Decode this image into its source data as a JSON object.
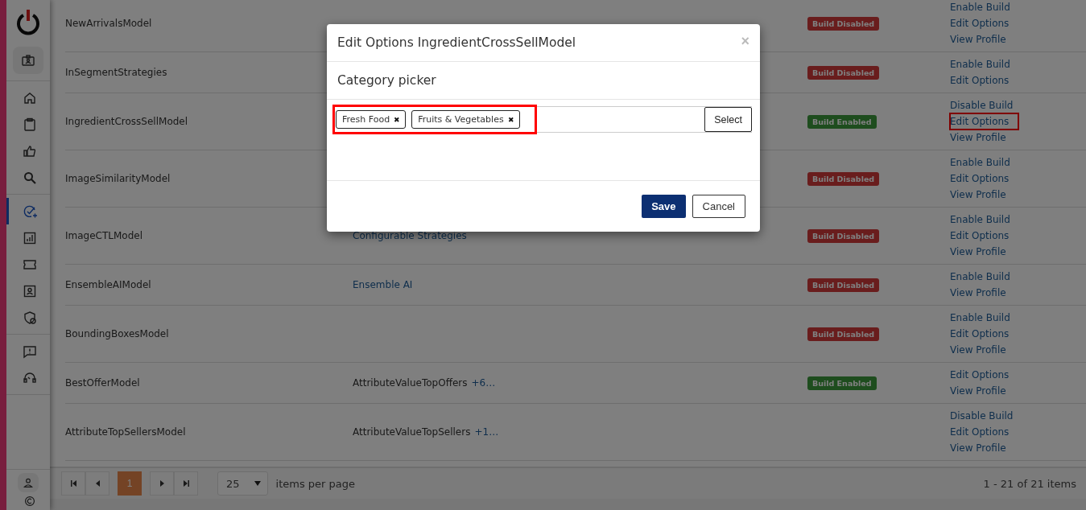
{
  "sidebar": {
    "groups": [
      {
        "items": [
          {
            "selected": false
          }
        ]
      },
      {
        "items": [
          {
            "selected": false
          },
          {
            "selected": false
          },
          {
            "selected": false
          },
          {
            "selected": false
          }
        ]
      },
      {
        "items": [
          {
            "selected": true
          },
          {
            "selected": false
          },
          {
            "selected": false
          },
          {
            "selected": false
          },
          {
            "selected": false
          }
        ]
      },
      {
        "items": [
          {
            "selected": false
          },
          {
            "selected": false
          }
        ]
      }
    ],
    "footer": [
      {
        "selected": false
      },
      {
        "selected": false
      }
    ]
  },
  "table": {
    "rows": [
      {
        "name": "NewArrivalsModel",
        "status": {
          "label": "Build Disabled",
          "kind": "disabled"
        },
        "actions": [
          {
            "label": "Enable Build",
            "highlighted": false
          },
          {
            "label": "Edit Options",
            "highlighted": false
          },
          {
            "label": "View Profile",
            "highlighted": false
          }
        ]
      },
      {
        "name": "InSegmentStrategies",
        "status": {
          "label": "Build Disabled",
          "kind": "disabled"
        },
        "actions": [
          {
            "label": "Enable Build",
            "highlighted": false
          },
          {
            "label": "Edit Options",
            "highlighted": false
          }
        ]
      },
      {
        "name": "IngredientCrossSellModel",
        "status": {
          "label": "Build Enabled",
          "kind": "enabled"
        },
        "actions": [
          {
            "label": "Disable Build",
            "highlighted": false
          },
          {
            "label": "Edit Options",
            "highlighted": true
          },
          {
            "label": "View Profile",
            "highlighted": false
          }
        ]
      },
      {
        "name": "ImageSimilarityModel",
        "status": {
          "label": "Build Disabled",
          "kind": "disabled"
        },
        "actions": [
          {
            "label": "Enable Build",
            "highlighted": false
          },
          {
            "label": "Edit Options",
            "highlighted": false
          },
          {
            "label": "View Profile",
            "highlighted": false
          }
        ]
      },
      {
        "name": "ImageCTLModel",
        "strategy": {
          "label": "Configurable Strategies",
          "kind": "link"
        },
        "status": {
          "label": "Build Disabled",
          "kind": "disabled"
        },
        "actions": [
          {
            "label": "Enable Build",
            "highlighted": false
          },
          {
            "label": "Edit Options",
            "highlighted": false
          },
          {
            "label": "View Profile",
            "highlighted": false
          }
        ]
      },
      {
        "name": "EnsembleAIModel",
        "strategy": {
          "label": "Ensemble AI",
          "kind": "link"
        },
        "status": {
          "label": "Build Disabled",
          "kind": "disabled"
        },
        "actions": [
          {
            "label": "Enable Build",
            "highlighted": false
          },
          {
            "label": "View Profile",
            "highlighted": false
          }
        ]
      },
      {
        "name": "BoundingBoxesModel",
        "status": {
          "label": "Build Disabled",
          "kind": "disabled"
        },
        "actions": [
          {
            "label": "Enable Build",
            "highlighted": false
          },
          {
            "label": "Edit Options",
            "highlighted": false
          },
          {
            "label": "View Profile",
            "highlighted": false
          }
        ]
      },
      {
        "name": "BestOfferModel",
        "strategy": {
          "label": "AttributeValueTopOffers",
          "kind": "text",
          "more": "+6…"
        },
        "status": {
          "label": "Build Enabled",
          "kind": "enabled"
        },
        "actions": [
          {
            "label": "Edit Options",
            "highlighted": false
          },
          {
            "label": "View Profile",
            "highlighted": false
          }
        ]
      },
      {
        "name": "AttributeTopSellersModel",
        "strategy": {
          "label": "AttributeValueTopSellers",
          "kind": "text",
          "more": "+1…"
        },
        "actions": [
          {
            "label": "Disable Build",
            "highlighted": false
          },
          {
            "label": "Edit Options",
            "highlighted": false
          },
          {
            "label": "View Profile",
            "highlighted": false
          }
        ]
      }
    ]
  },
  "pager": {
    "buttons": [
      {
        "kind": "first"
      },
      {
        "kind": "prev"
      }
    ],
    "pages": [
      {
        "label": "1",
        "selected": true
      }
    ],
    "buttons_after": [
      {
        "kind": "next"
      },
      {
        "kind": "last"
      }
    ],
    "page_size": "25",
    "page_size_label": "items per page",
    "summary": "1 - 21 of 21 items"
  },
  "modal": {
    "title": "Edit Options IngredientCrossSellModel",
    "close": "×",
    "section": "Category picker",
    "chips": [
      {
        "label": "Fresh Food",
        "remove": "✖"
      },
      {
        "label": "Fruits & Vegetables",
        "remove": "✖"
      }
    ],
    "chips_highlighted": true,
    "select": "Select",
    "save": "Save",
    "cancel": "Cancel"
  }
}
